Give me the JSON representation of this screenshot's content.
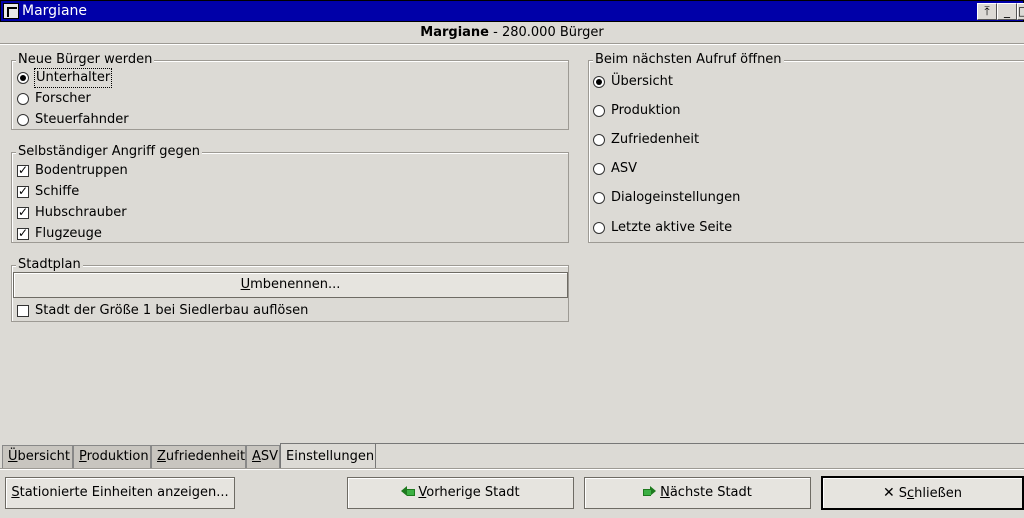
{
  "window": {
    "title": "Margiane",
    "buttons": {
      "stick": "⤒",
      "minimize": "_",
      "maximize": "□"
    }
  },
  "header": {
    "city": "Margiane",
    "population": " - 280.000 Bürger"
  },
  "citizens": {
    "legend": "Neue Bürger werden",
    "options": [
      {
        "label": "Unterhalter",
        "checked": true
      },
      {
        "label": "Forscher",
        "checked": false
      },
      {
        "label": "Steuerfahnder",
        "checked": false
      }
    ]
  },
  "attack": {
    "legend": "Selbständiger Angriff gegen",
    "options": [
      {
        "label": "Bodentruppen",
        "checked": true
      },
      {
        "label": "Schiffe",
        "checked": true
      },
      {
        "label": "Hubschrauber",
        "checked": true
      },
      {
        "label": "Flugzeuge",
        "checked": true
      }
    ]
  },
  "cityplan": {
    "legend": "Stadtplan",
    "rename_mnemonic": "U",
    "rename_rest": "mbenennen...",
    "disband_label": "Stadt der Größe 1 bei Siedlerbau auflösen",
    "disband_checked": false
  },
  "next_open": {
    "legend": "Beim nächsten Aufruf öffnen",
    "options": [
      {
        "label": "Übersicht",
        "checked": true
      },
      {
        "label": "Produktion",
        "checked": false
      },
      {
        "label": "Zufriedenheit",
        "checked": false
      },
      {
        "label": "ASV",
        "checked": false
      },
      {
        "label": "Dialogeinstellungen",
        "checked": false
      },
      {
        "label": "Letzte aktive Seite",
        "checked": false
      }
    ]
  },
  "tabs": [
    {
      "mnemonic": "Ü",
      "rest": "bersicht"
    },
    {
      "mnemonic": "P",
      "rest": "roduktion"
    },
    {
      "mnemonic": "Z",
      "rest": "ufriedenheit"
    },
    {
      "mnemonic": "A",
      "rest": "SV"
    },
    {
      "mnemonic": "",
      "rest": "Einstellungen"
    }
  ],
  "footer": {
    "units_mnemonic": "S",
    "units_rest": "tationierte Einheiten anzeigen...",
    "prev_mnemonic": "V",
    "prev_rest": "orherige Stadt",
    "next_mnemonic": "N",
    "next_rest": "ächste Stadt",
    "close_pre": "S",
    "close_mnemonic": "c",
    "close_rest": "hließen"
  },
  "colors": {
    "titlebar": "#0000a8",
    "background": "#dcdad5"
  },
  "icons": {
    "prev": "arrow-left-icon",
    "next": "arrow-right-icon",
    "close": "close-icon"
  }
}
